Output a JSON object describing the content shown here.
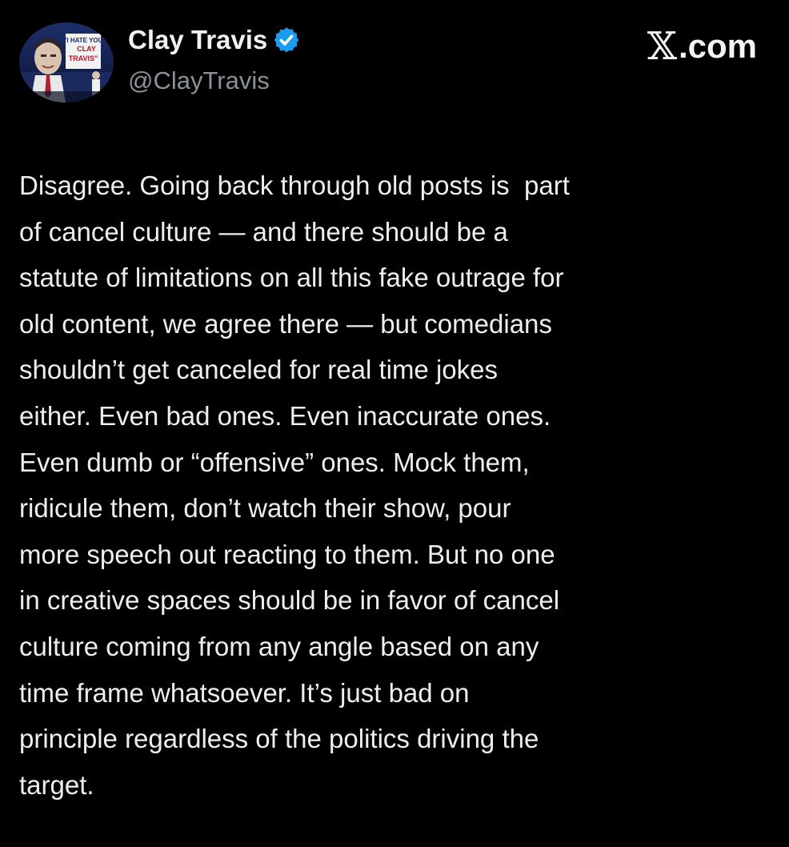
{
  "author": {
    "display_name": "Clay Travis",
    "handle": "@ClayTravis",
    "verified": true,
    "avatar_sign_lines": [
      "\"I HATE YOU",
      "CLAY",
      "TRAVIS\""
    ]
  },
  "brand": {
    "logo_icon": "x-logo-icon",
    "label": ".com"
  },
  "post": {
    "lines": [
      "Disagree. Going back through old posts is  part",
      "of cancel culture — and there should be a",
      "statute of limitations on all this fake outrage for",
      "old content, we agree there — but comedians",
      "shouldn’t get canceled for real time jokes",
      "either. Even bad ones. Even inaccurate ones.",
      "Even dumb or “offensive” ones. Mock them,",
      "ridicule them, don’t watch their show, pour",
      "more speech out reacting to them. But no one",
      "in creative spaces should be in favor of cancel",
      "culture coming from any angle based on any",
      "time frame whatsoever. It’s just bad on",
      "principle regardless of the politics driving the",
      "target."
    ]
  },
  "colors": {
    "background": "#000000",
    "text_primary": "#eceef0",
    "text_secondary": "#8b9197",
    "verified_blue": "#1d9bf0"
  }
}
